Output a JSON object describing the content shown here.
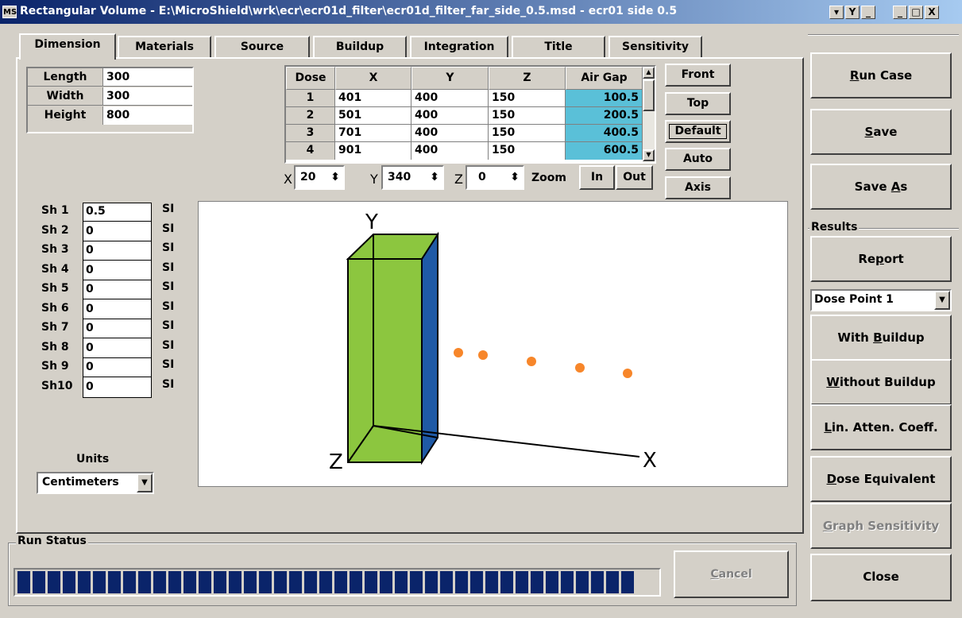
{
  "window": {
    "app_icon": "MS",
    "title": "Rectangular Volume - E:\\MicroShield\\wrk\\ecr\\ecr01d_filter\\ecr01d_filter_far_side_0.5.msd - ecr01 side 0.5",
    "buttons": [
      "▾",
      "Y",
      "_",
      "_",
      "□",
      "X"
    ]
  },
  "tabs": [
    "Dimension",
    "Materials",
    "Source",
    "Buildup",
    "Integration",
    "Title",
    "Sensitivity"
  ],
  "dimensions": [
    {
      "label": "Length",
      "value": "300"
    },
    {
      "label": "Width",
      "value": "300"
    },
    {
      "label": "Height",
      "value": "800"
    }
  ],
  "dose_table": {
    "headers": [
      "Dose",
      "X",
      "Y",
      "Z",
      "Air Gap"
    ],
    "rows": [
      [
        "1",
        "401",
        "400",
        "150",
        "100.5"
      ],
      [
        "2",
        "501",
        "400",
        "150",
        "200.5"
      ],
      [
        "3",
        "701",
        "400",
        "150",
        "400.5"
      ],
      [
        "4",
        "901",
        "400",
        "150",
        "600.5"
      ]
    ]
  },
  "view_buttons": [
    "Front",
    "Top",
    "Default",
    "Auto",
    "Axis"
  ],
  "view": {
    "x_label": "X",
    "x_value": "20",
    "y_label": "Y",
    "y_value": "340",
    "z_label": "Z",
    "z_value": "0",
    "zoom_label": "Zoom",
    "zoom_in": "In",
    "zoom_out": "Out"
  },
  "shields": [
    {
      "label": "Sh 1",
      "value": "0.5",
      "unit": "SI"
    },
    {
      "label": "Sh 2",
      "value": "0",
      "unit": "SI"
    },
    {
      "label": "Sh 3",
      "value": "0",
      "unit": "SI"
    },
    {
      "label": "Sh 4",
      "value": "0",
      "unit": "SI"
    },
    {
      "label": "Sh 5",
      "value": "0",
      "unit": "SI"
    },
    {
      "label": "Sh 6",
      "value": "0",
      "unit": "SI"
    },
    {
      "label": "Sh 7",
      "value": "0",
      "unit": "SI"
    },
    {
      "label": "Sh 8",
      "value": "0",
      "unit": "SI"
    },
    {
      "label": "Sh 9",
      "value": "0",
      "unit": "SI"
    },
    {
      "label": "Sh10",
      "value": "0",
      "unit": "SI"
    }
  ],
  "units": {
    "label": "Units",
    "value": "Centimeters"
  },
  "axes": {
    "x": "X",
    "y": "Y",
    "z": "Z"
  },
  "colors": {
    "box_front": "#8cc63f",
    "box_side": "#1f5aa6",
    "dose_point": "#f7862a",
    "air_gap": "#5ac0d8",
    "progress": "#0a246a"
  },
  "right_panel": {
    "run_case": "Run Case",
    "save": "Save",
    "save_as": "Save As",
    "results_label": "Results",
    "report": "Report",
    "dose_point_select": "Dose Point 1",
    "with_buildup": "With Buildup",
    "without_buildup": "Without Buildup",
    "lin_atten": "Lin. Atten. Coeff.",
    "dose_equivalent": "Dose Equivalent",
    "graph_sensitivity": "Graph Sensitivity",
    "close": "Close"
  },
  "run_status": {
    "label": "Run Status",
    "cancel": "Cancel"
  }
}
